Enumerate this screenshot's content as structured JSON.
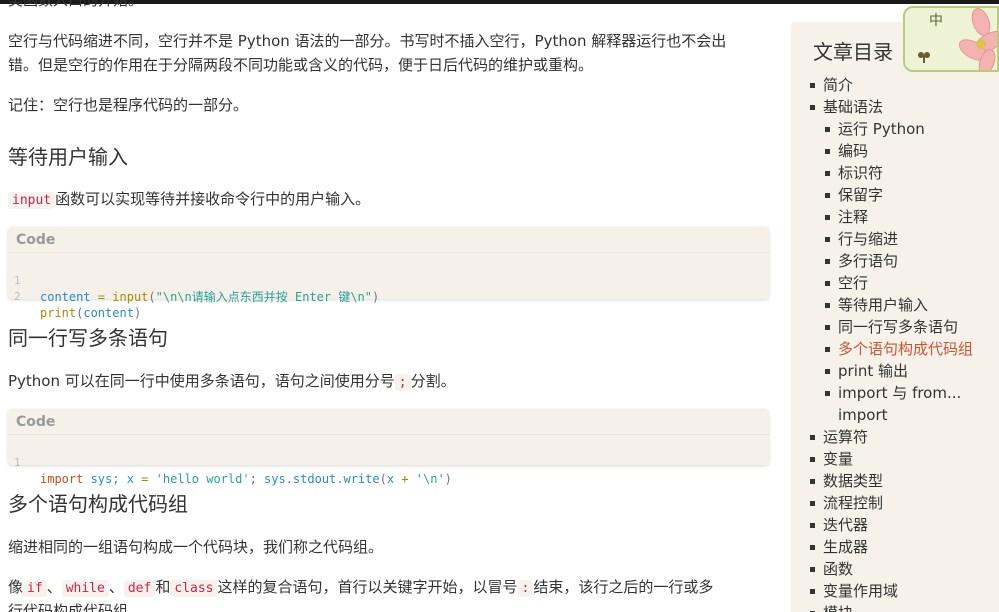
{
  "article": {
    "top_cut_text": "类函数入口的开始。",
    "p_blank_1": "空行与代码缩进不同，空行并不是 Python 语法的一部分。书写时不插入空行，Python 解释器运行也不会出",
    "p_blank_2": "错。但是空行的作用在于分隔两段不同功能或含义的代码，便于日后代码的维护或重构。",
    "p_remember": "记住：空行也是程序代码的一部分。",
    "h_wait": "等待用户输入",
    "p_input_code": "input",
    "p_input_text": "函数可以实现等待并接收命令行中的用户输入。",
    "h_sameline": "同一行写多条语句",
    "p_sameline_a": "Python 可以在同一行中使用多条语句，语句之间使用分号",
    "p_sameline_code": ";",
    "p_sameline_b": "分割。",
    "h_group": "多个语句构成代码组",
    "p_group": "缩进相同的一组语句构成一个代码块，我们称之代码组。",
    "p_compound_a": "像",
    "kw_if": "if",
    "sep1": "、",
    "kw_while": "while",
    "sep2": "、",
    "kw_def": "def",
    "and": "和",
    "kw_class": "class",
    "p_compound_b": "这样的复合语句，首行以关键字开始，以冒号",
    "colon_code": ":",
    "p_compound_c": "结束，该行之后的一行或多",
    "p_compound_d": "行代码构成代码组。"
  },
  "code1": {
    "caption": "Code",
    "lines": [
      {
        "num": "1",
        "var": "content",
        "eq": " = ",
        "fn": "input",
        "open": "(",
        "str": "\"\\n\\n请输入点东西并按 Enter 键\\n\"",
        "close": ")"
      },
      {
        "num": "2",
        "fn": "print",
        "open": "(",
        "arg": "content",
        "close": ")"
      }
    ]
  },
  "code2": {
    "caption": "Code",
    "line": {
      "num": "1",
      "kw": "import",
      "mod": " sys",
      "semi1": "; ",
      "x": "x",
      "eq": " = ",
      "str1": "'hello world'",
      "semi2": "; ",
      "call": "sys.stdout.write",
      "open": "(",
      "x2": "x",
      "plus": " + ",
      "str2": "'\\n'",
      "close": ")"
    }
  },
  "toc": {
    "title": "文章目录",
    "items": [
      {
        "label": "简介",
        "level": 1
      },
      {
        "label": "基础语法",
        "level": 1
      },
      {
        "label": "运行 Python",
        "level": 2
      },
      {
        "label": "编码",
        "level": 2
      },
      {
        "label": "标识符",
        "level": 2
      },
      {
        "label": "保留字",
        "level": 2
      },
      {
        "label": "注释",
        "level": 2
      },
      {
        "label": "行与缩进",
        "level": 2
      },
      {
        "label": "多行语句",
        "level": 2
      },
      {
        "label": "空行",
        "level": 2
      },
      {
        "label": "等待用户输入",
        "level": 2
      },
      {
        "label": "同一行写多条语句",
        "level": 2
      },
      {
        "label": "多个语句构成代码组",
        "level": 2,
        "active": true
      },
      {
        "label": "print 输出",
        "level": 2
      },
      {
        "label": "import 与 from...",
        "level": 2
      },
      {
        "label": "import",
        "level": 2,
        "continuation": true
      },
      {
        "label": "运算符",
        "level": 1
      },
      {
        "label": "变量",
        "level": 1
      },
      {
        "label": "数据类型",
        "level": 1
      },
      {
        "label": "流程控制",
        "level": 1
      },
      {
        "label": "迭代器",
        "level": 1
      },
      {
        "label": "生成器",
        "level": 1
      },
      {
        "label": "函数",
        "level": 1
      },
      {
        "label": "变量作用域",
        "level": 1
      },
      {
        "label": "模块",
        "level": 1
      }
    ]
  },
  "widget": {
    "label": "中",
    "moon_icon": "moon-icon",
    "flower_icon": "flower-icon"
  },
  "colors": {
    "accent_active": "#cc5533",
    "inline_code": "#c7254e",
    "sidebar_bg": "#f6f2ea",
    "code_bg": "#f6f1e8"
  }
}
